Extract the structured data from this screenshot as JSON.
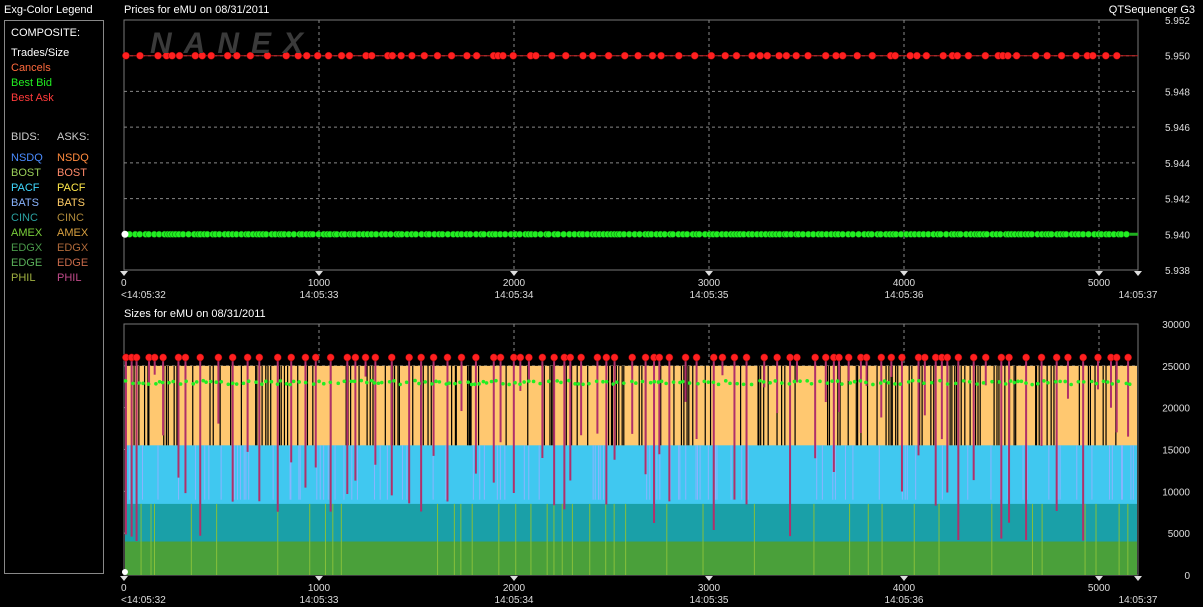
{
  "legend": {
    "title": "Exg-Color Legend",
    "composite_header": "COMPOSITE:",
    "composite_items": [
      {
        "label": "Trades/Size",
        "color": "#ffffff"
      },
      {
        "label": "Cancels",
        "color": "#ff6a3d"
      },
      {
        "label": "Best Bid",
        "color": "#22ee22"
      },
      {
        "label": "Best Ask",
        "color": "#ff3b3b"
      }
    ],
    "bids_header": "BIDS:",
    "asks_header": "ASKS:",
    "exchanges": [
      {
        "bid": "NSDQ",
        "bid_color": "#4a8cff",
        "ask": "NSDQ",
        "ask_color": "#ff8a3d"
      },
      {
        "bid": "BOST",
        "bid_color": "#9ad05a",
        "ask": "BOST",
        "ask_color": "#ff8a6a"
      },
      {
        "bid": "PACF",
        "bid_color": "#40d8ff",
        "ask": "PACF",
        "ask_color": "#ffe84a"
      },
      {
        "bid": "BATS",
        "bid_color": "#8ab4ff",
        "ask": "BATS",
        "ask_color": "#ffcc66"
      },
      {
        "bid": "CINC",
        "bid_color": "#2aa0a0",
        "ask": "CINC",
        "ask_color": "#b08a3a"
      },
      {
        "bid": "AMEX",
        "bid_color": "#7ad03a",
        "ask": "AMEX",
        "ask_color": "#d8a040"
      },
      {
        "bid": "EDGX",
        "bid_color": "#4a9a4a",
        "ask": "EDGX",
        "ask_color": "#b06a3a"
      },
      {
        "bid": "EDGE",
        "bid_color": "#5ab05a",
        "ask": "EDGE",
        "ask_color": "#c86a4a"
      },
      {
        "bid": "PHIL",
        "bid_color": "#a0b040",
        "ask": "PHIL",
        "ask_color": "#c04a8a"
      }
    ]
  },
  "header": {
    "prices_title": "Prices for  eMU  on  08/31/2011",
    "sizes_title": "Sizes for  eMU  on  08/31/2011",
    "app_name": "QTSequencer G3",
    "watermark": "NANEX"
  },
  "chart_data": [
    {
      "type": "scatter",
      "title": "Prices for  eMU  on  08/31/2011",
      "xlim": [
        0,
        5200
      ],
      "ylim": [
        5.938,
        5.952
      ],
      "y_ticks": [
        "5.952",
        "5.950",
        "5.948",
        "5.946",
        "5.944",
        "5.942",
        "5.940",
        "5.938"
      ],
      "x_ticks": [
        {
          "x": 0,
          "label": "0",
          "time": "<14:05:32"
        },
        {
          "x": 1000,
          "label": "1000",
          "time": "14:05:33"
        },
        {
          "x": 2000,
          "label": "2000",
          "time": "14:05:34"
        },
        {
          "x": 3000,
          "label": "3000",
          "time": "14:05:35"
        },
        {
          "x": 4000,
          "label": "4000",
          "time": "14:05:36"
        },
        {
          "x": 5000,
          "label": "5000",
          "time": ""
        },
        {
          "x": 5200,
          "label": "",
          "time": "14:05:37"
        }
      ],
      "series": [
        {
          "name": "Best Ask",
          "color": "#ff2020",
          "price": 5.95
        },
        {
          "name": "Best Bid",
          "color": "#22ee22",
          "price": 5.94
        }
      ],
      "grid": true
    },
    {
      "type": "bar",
      "title": "Sizes for  eMU  on  08/31/2011",
      "xlim": [
        0,
        5200
      ],
      "ylim": [
        0,
        30000
      ],
      "y_ticks": [
        "30000",
        "25000",
        "20000",
        "15000",
        "10000",
        "5000",
        "0"
      ],
      "x_ticks": [
        {
          "x": 0,
          "label": "0",
          "time": "<14:05:32"
        },
        {
          "x": 1000,
          "label": "1000",
          "time": "14:05:33"
        },
        {
          "x": 2000,
          "label": "2000",
          "time": "14:05:34"
        },
        {
          "x": 3000,
          "label": "3000",
          "time": "14:05:35"
        },
        {
          "x": 4000,
          "label": "4000",
          "time": "14:05:36"
        },
        {
          "x": 5000,
          "label": "5000",
          "time": ""
        },
        {
          "x": 5200,
          "label": "",
          "time": "14:05:37"
        }
      ],
      "stack": [
        {
          "name": "AMEX",
          "color": "#4aa03a",
          "value": 4000
        },
        {
          "name": "CINC",
          "color": "#1aa0a8",
          "value": 8500
        },
        {
          "name": "PACF",
          "color": "#40c8f0",
          "value": 15500
        },
        {
          "name": "BATS",
          "color": "#ffc870",
          "value": 25000
        }
      ],
      "ask_marker_size": 26000,
      "bid_marker_size": 23000,
      "grid": true
    }
  ]
}
